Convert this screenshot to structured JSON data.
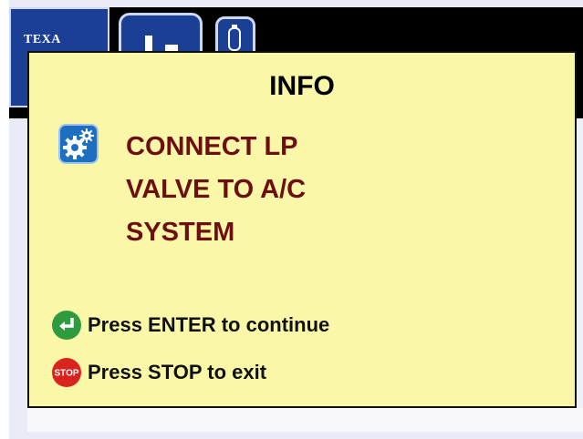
{
  "app": {
    "logo_text": "TEXA"
  },
  "dialog": {
    "title": "INFO",
    "message_lines": [
      "CONNECT LP",
      "VALVE TO A/C",
      "SYSTEM"
    ],
    "icon": "gear-icon",
    "actions": [
      {
        "icon": "enter-icon",
        "label": "Press ENTER to continue",
        "color": "#2f9a3e"
      },
      {
        "icon": "stop-icon",
        "label": "Press STOP to exit",
        "color": "#d8231f",
        "icon_text": "STOP"
      }
    ]
  },
  "colors": {
    "dialog_bg": "#faf7a8",
    "message_text": "#6b0f10",
    "tile_blue": "#1b3f95"
  }
}
